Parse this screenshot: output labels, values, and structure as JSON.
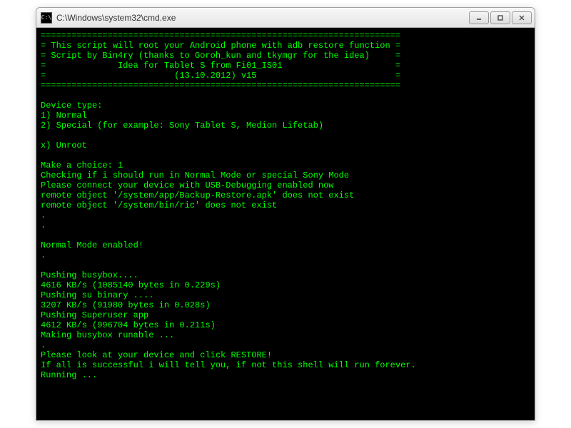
{
  "window": {
    "title": "C:\\Windows\\system32\\cmd.exe",
    "icon_label": "C:\\"
  },
  "terminal": {
    "lines": [
      "======================================================================",
      "= This script will root your Android phone with adb restore function =",
      "= Script by Bin4ry (thanks to Goroh_kun and tkymgr for the idea)     =",
      "=              Idea for Tablet S from Fi01_IS01                      =",
      "=                         (13.10.2012) v15                           =",
      "======================================================================",
      "",
      "Device type:",
      "1) Normal",
      "2) Special (for example: Sony Tablet S, Medion Lifetab)",
      "",
      "x) Unroot",
      "",
      "Make a choice: 1",
      "Checking if i should run in Normal Mode or special Sony Mode",
      "Please connect your device with USB-Debugging enabled now",
      "remote object '/system/app/Backup-Restore.apk' does not exist",
      "remote object '/system/bin/ric' does not exist",
      ".",
      ".",
      "",
      "Normal Mode enabled!",
      ".",
      "",
      "Pushing busybox....",
      "4616 KB/s (1085140 bytes in 0.229s)",
      "Pushing su binary ....",
      "3207 KB/s (91980 bytes in 0.028s)",
      "Pushing Superuser app",
      "4612 KB/s (996704 bytes in 0.211s)",
      "Making busybox runable ...",
      ".",
      "Please look at your device and click RESTORE!",
      "If all is successful i will tell you, if not this shell will run forever.",
      "Running ..."
    ]
  }
}
